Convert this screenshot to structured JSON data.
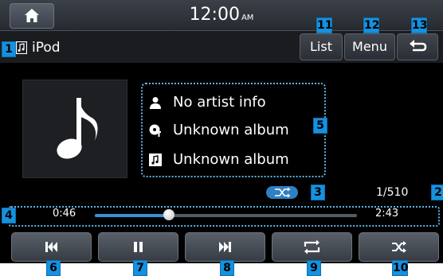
{
  "status_bar": {
    "time": "12:00",
    "ampm": "AM"
  },
  "header": {
    "source_label": "iPod",
    "list_label": "List",
    "menu_label": "Menu"
  },
  "track": {
    "artist": "No artist info",
    "album": "Unknown album",
    "title": "Unknown album",
    "counter": "1/510"
  },
  "playback": {
    "elapsed": "0:46",
    "duration": "2:43",
    "progress_fraction": 0.282
  },
  "controls": [
    "previous-icon",
    "pause-icon",
    "next-icon",
    "repeat-icon",
    "shuffle-icon"
  ],
  "callouts": {
    "source": "1",
    "counter": "2",
    "shuffle_badge": "3",
    "progress": "4",
    "info": "5",
    "prev": "6",
    "pause": "7",
    "next": "8",
    "repeat": "9",
    "shuffle": "10",
    "list": "11",
    "menu": "12",
    "back": "13"
  },
  "colors": {
    "accent": "#1591e0",
    "progress_fill": "#3b8fd6",
    "background": "#000000"
  }
}
